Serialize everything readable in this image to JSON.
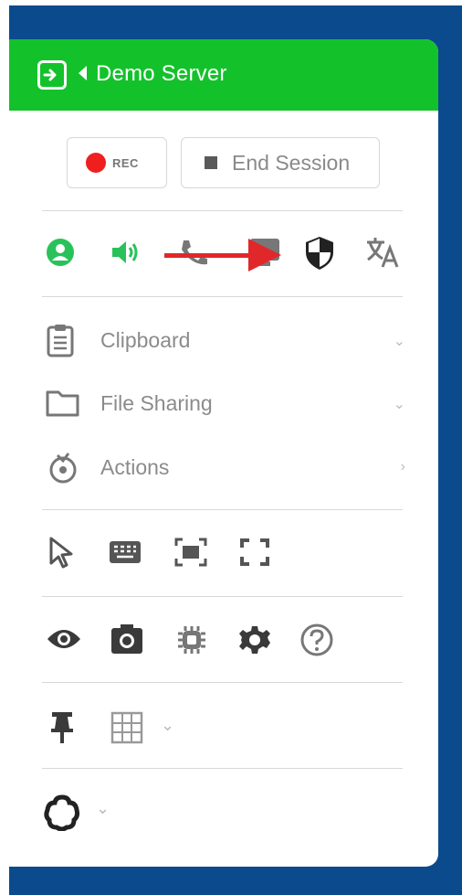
{
  "header": {
    "title": "Demo Server",
    "accent": "#13c22b"
  },
  "session_buttons": {
    "rec_label": "REC",
    "end_label": "End Session"
  },
  "top_icons": [
    "user-icon",
    "speaker-icon",
    "phone-icon",
    "monitor-icon",
    "shield-icon",
    "translate-icon"
  ],
  "menu": {
    "items": [
      {
        "label": "Clipboard",
        "icon": "clipboard-icon",
        "chevron": "⌄"
      },
      {
        "label": "File Sharing",
        "icon": "folder-icon",
        "chevron": "⌄"
      },
      {
        "label": "Actions",
        "icon": "actions-icon",
        "chevron": "›"
      }
    ]
  },
  "tool_icons": [
    "pointer-icon",
    "keyboard-icon",
    "fit-screen-icon",
    "fullscreen-icon"
  ],
  "view_icons": [
    "eye-icon",
    "camera-icon",
    "chip-icon",
    "gear-icon",
    "help-icon"
  ],
  "pin_row": {
    "grid_chevron": "⌄"
  },
  "bottom_row": {
    "logo_chevron": "⌄"
  },
  "colors": {
    "background": "#0b4a8c",
    "annotation_arrow": "#e0282a",
    "active_icon": "#29c25a"
  }
}
